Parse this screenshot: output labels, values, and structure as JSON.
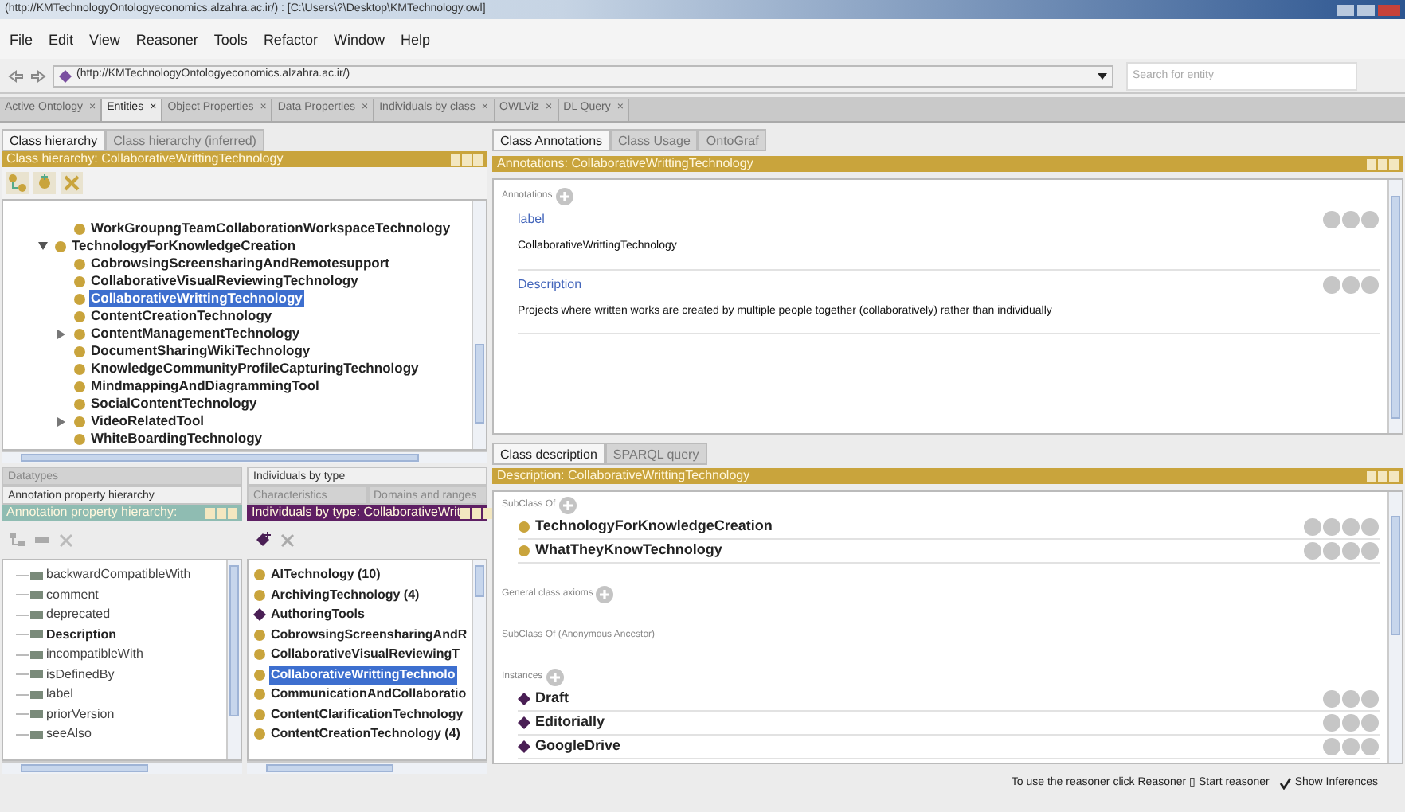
{
  "window": {
    "title": "(http://KMTechnologyOntologyeconomics.alzahra.ac.ir/) : [C:\\Users\\?\\Desktop\\KMTechnology.owl]"
  },
  "menu": [
    "File",
    "Edit",
    "View",
    "Reasoner",
    "Tools",
    "Refactor",
    "Window",
    "Help"
  ],
  "address": {
    "value": "(http://KMTechnologyOntologyeconomics.alzahra.ac.ir/)"
  },
  "search": {
    "placeholder": "Search for entity"
  },
  "workspace_tabs": [
    {
      "label": "Active Ontology",
      "close": "×",
      "selected": false
    },
    {
      "label": "Entities",
      "close": "×",
      "selected": true
    },
    {
      "label": "Object Properties",
      "close": "×",
      "selected": false
    },
    {
      "label": "Data Properties",
      "close": "×",
      "selected": false
    },
    {
      "label": "Individuals by class",
      "close": "×",
      "selected": false
    },
    {
      "label": "OWLViz",
      "close": "×",
      "selected": false
    },
    {
      "label": "DL Query",
      "close": "×",
      "selected": false
    }
  ],
  "class_hierarchy": {
    "tabs": [
      {
        "label": "Class hierarchy",
        "selected": true
      },
      {
        "label": "Class hierarchy (inferred)",
        "selected": false
      }
    ],
    "header": "Class hierarchy: CollaborativeWrittingTechnology",
    "tree": [
      {
        "children": [
          {
            "label": "WorkGroupngTeamCollaborationWorkspaceTechnology",
            "selected": false
          }
        ]
      },
      {
        "label": "TechnologyForKnowledgeCreation",
        "selected": false,
        "expanded": true,
        "children": [
          {
            "label": "CobrowsingScreensharingAndRemotesupport",
            "selected": false
          },
          {
            "label": "CollaborativeVisualReviewingTechnology",
            "selected": false
          },
          {
            "label": "CollaborativeWrittingTechnology",
            "selected": true
          },
          {
            "label": "ContentCreationTechnology",
            "selected": false
          },
          {
            "label": "ContentManagementTechnology",
            "selected": false,
            "expanded": false
          },
          {
            "label": "DocumentSharingWikiTechnology",
            "selected": false
          },
          {
            "label": "KnowledgeCommunityProfileCapturingTechnology",
            "selected": false
          },
          {
            "label": "MindmappingAndDiagrammingTool",
            "selected": false
          },
          {
            "label": "SocialContentTechnology",
            "selected": false
          },
          {
            "label": "VideoRelatedTool",
            "selected": false,
            "expanded": false
          },
          {
            "label": "WhiteBoardingTechnology",
            "selected": false
          }
        ]
      }
    ]
  },
  "annotation_properties": {
    "tabs": [
      {
        "label": "Datatypes",
        "selected": false
      },
      {
        "label": "Annotation property hierarchy",
        "selected": true
      }
    ],
    "header": "Annotation property hierarchy:",
    "items": [
      {
        "label": "backwardCompatibleWith",
        "bold": false
      },
      {
        "label": "comment",
        "bold": false
      },
      {
        "label": "deprecated",
        "bold": false
      },
      {
        "label": "Description",
        "bold": true
      },
      {
        "label": "incompatibleWith",
        "bold": false
      },
      {
        "label": "isDefinedBy",
        "bold": false
      },
      {
        "label": "label",
        "bold": false
      },
      {
        "label": "priorVersion",
        "bold": false
      },
      {
        "label": "seeAlso",
        "bold": false
      }
    ]
  },
  "individuals": {
    "tabs": [
      {
        "label": "Individuals by type",
        "selected": true
      },
      {
        "label": "Characteristics",
        "selected": false
      },
      {
        "label": "Domains and ranges",
        "selected": false
      }
    ],
    "header": "Individuals by type: CollaborativeWrit",
    "items": [
      {
        "label": "AITechnology (10)",
        "kind": "class",
        "selected": false
      },
      {
        "label": "ArchivingTechnology (4)",
        "kind": "class",
        "selected": false
      },
      {
        "label": "AuthoringTools",
        "kind": "individual",
        "selected": false
      },
      {
        "label": "CobrowsingScreensharingAndR",
        "kind": "class",
        "selected": false
      },
      {
        "label": "CollaborativeVisualReviewingT",
        "kind": "class",
        "selected": false
      },
      {
        "label": "CollaborativeWrittingTechnolo",
        "kind": "class",
        "selected": true
      },
      {
        "label": "CommunicationAndCollaboratio",
        "kind": "class",
        "selected": false
      },
      {
        "label": "ContentClarificationTechnology",
        "kind": "class",
        "selected": false
      },
      {
        "label": "ContentCreationTechnology (4)",
        "kind": "class",
        "selected": false
      }
    ]
  },
  "annotations_view": {
    "tabs": [
      {
        "label": "Class Annotations",
        "selected": true
      },
      {
        "label": "Class Usage",
        "selected": false
      },
      {
        "label": "OntoGraf",
        "selected": false
      }
    ],
    "header": "Annotations: CollaborativeWrittingTechnology",
    "section": "Annotations",
    "items": [
      {
        "property": "label",
        "value": "CollaborativeWrittingTechnology"
      },
      {
        "property": "Description",
        "value": "Projects where written works are created by multiple people together (collaboratively) rather than individually"
      }
    ]
  },
  "description_view": {
    "tabs": [
      {
        "label": "Class description",
        "selected": true
      },
      {
        "label": "SPARQL query",
        "selected": false
      }
    ],
    "header": "Description: CollaborativeWrittingTechnology",
    "sections": [
      {
        "title": "SubClass Of",
        "add": true,
        "items": [
          {
            "label": "TechnologyForKnowledgeCreation",
            "kind": "class"
          },
          {
            "label": "WhatTheyKnowTechnology",
            "kind": "class"
          }
        ]
      },
      {
        "title": "General class axioms",
        "add": true
      },
      {
        "title": "SubClass Of (Anonymous Ancestor)"
      },
      {
        "title": "Instances",
        "add": true,
        "items": [
          {
            "label": "Draft",
            "kind": "individual"
          },
          {
            "label": "Editorially",
            "kind": "individual"
          },
          {
            "label": "GoogleDrive",
            "kind": "individual"
          }
        ]
      }
    ]
  },
  "status_bar": {
    "message": "To use the reasoner click Reasoner ▯ Start reasoner",
    "show_inferences": {
      "label": "Show Inferences",
      "checked": true
    }
  }
}
